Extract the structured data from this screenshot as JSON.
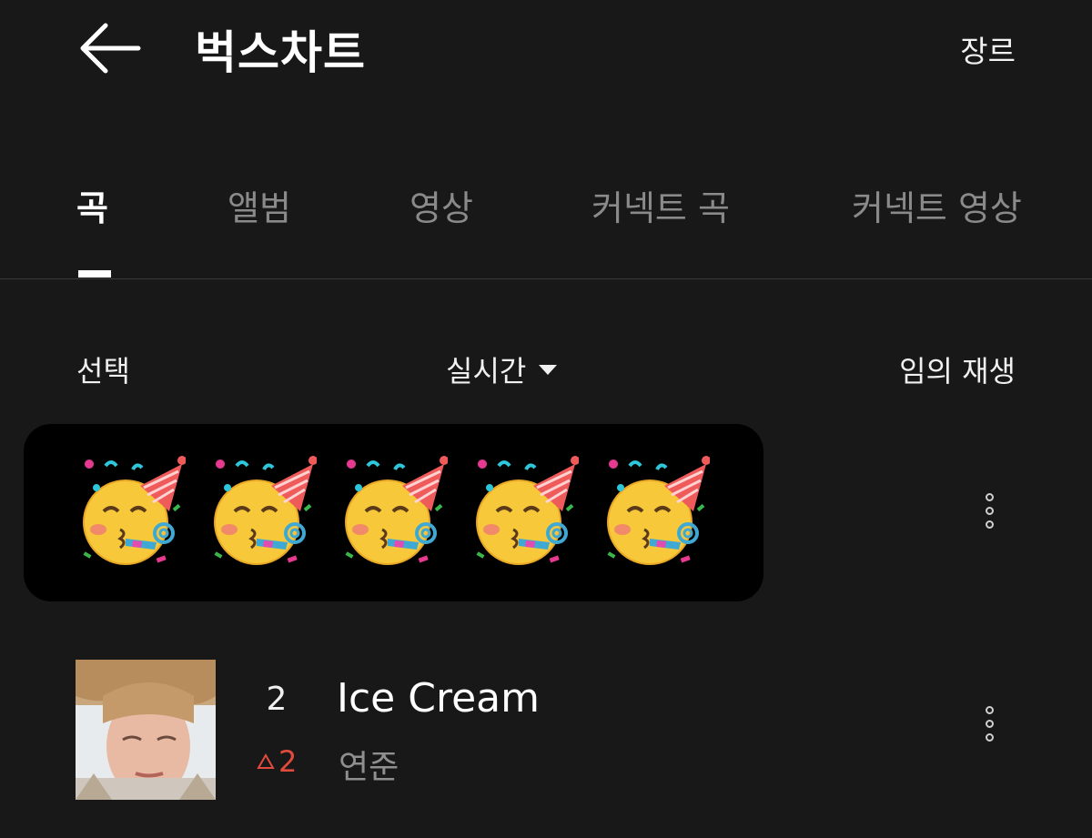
{
  "header": {
    "back_icon": "arrow-left-icon",
    "title": "벅스차트",
    "genre_label": "장르"
  },
  "tabs": [
    {
      "label": "곡",
      "active": true
    },
    {
      "label": "앨범",
      "active": false
    },
    {
      "label": "영상",
      "active": false
    },
    {
      "label": "커넥트 곡",
      "active": false
    },
    {
      "label": "커넥트 영상",
      "active": false
    }
  ],
  "controls": {
    "select_label": "선택",
    "period_label": "실시간",
    "period_icon": "caret-down-icon",
    "shuffle_label": "임의 재생"
  },
  "chart_items": [
    {
      "content": "🥳🥳🥳🥳🥳",
      "icon": "partying-face-emoji",
      "more_icon": "more-vertical-icon"
    },
    {
      "rank": "2",
      "change": "2",
      "change_icon": "triangle-up-icon",
      "title": "Ice Cream",
      "artist": "연준",
      "more_icon": "more-vertical-icon"
    }
  ],
  "colors": {
    "background": "#181818",
    "card": "#000000",
    "rank_up": "#e24a3b",
    "inactive_tab": "#8a8a8a"
  }
}
